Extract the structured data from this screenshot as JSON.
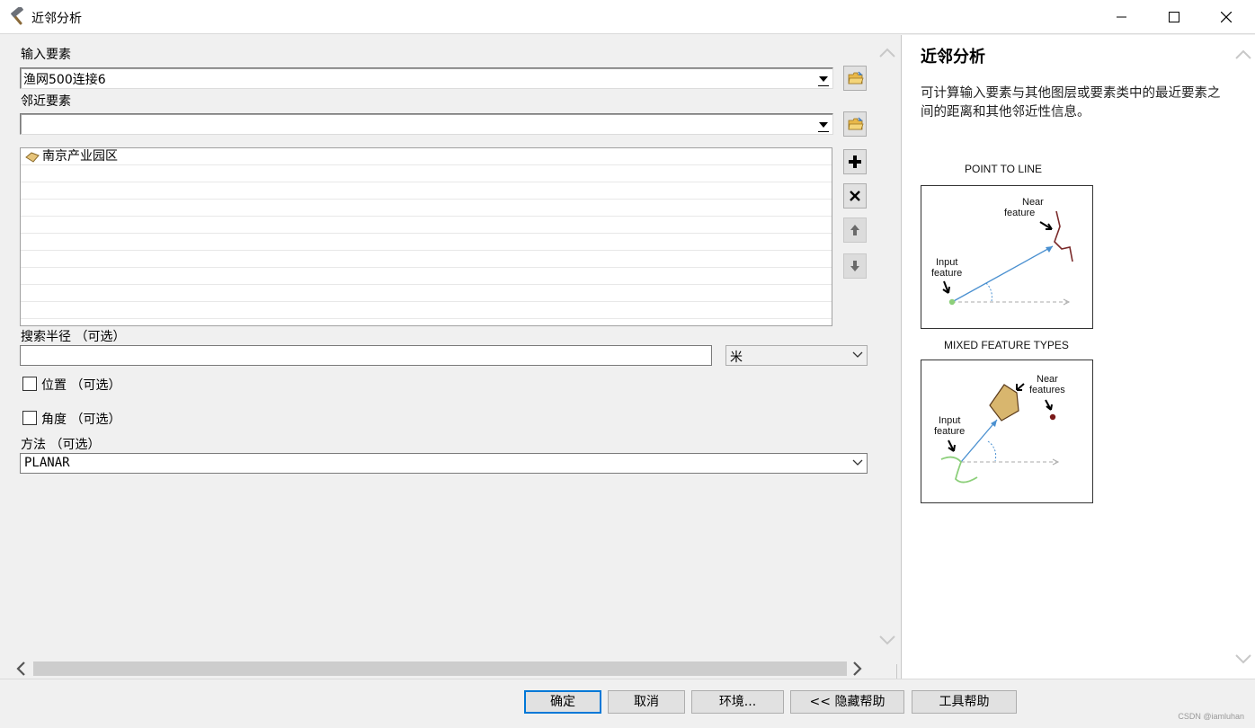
{
  "window": {
    "title": "近邻分析",
    "app_icon": "hammer-icon"
  },
  "form": {
    "input_features": {
      "label": "输入要素",
      "value": "渔网500连接6"
    },
    "near_features": {
      "label": "邻近要素",
      "value": "",
      "items": [
        {
          "label": "南京产业园区",
          "icon": "polygon-layer-icon"
        }
      ]
    },
    "search_radius": {
      "label": "搜索半径 （可选）",
      "value": "",
      "unit": "米"
    },
    "location": {
      "label": "位置 （可选）",
      "checked": false
    },
    "angle": {
      "label": "角度 （可选）",
      "checked": false
    },
    "method": {
      "label": "方法 （可选）",
      "value": "PLANAR"
    }
  },
  "help": {
    "title": "近邻分析",
    "description": "可计算输入要素与其他图层或要素类中的最近要素之间的距离和其他邻近性信息。",
    "diagram1": {
      "caption": "POINT TO LINE",
      "near_label_1": "Near",
      "near_label_2": "feature",
      "input_label_1": "Input",
      "input_label_2": "feature"
    },
    "diagram2": {
      "caption": "MIXED FEATURE TYPES",
      "near_label_1": "Near",
      "near_label_2": "features",
      "input_label_1": "Input",
      "input_label_2": "feature"
    }
  },
  "buttons": {
    "ok": "确定",
    "cancel": "取消",
    "environments": "环境...",
    "hide_help": "<< 隐藏帮助",
    "tool_help": "工具帮助"
  },
  "watermark": "CSDN @iamluhan"
}
